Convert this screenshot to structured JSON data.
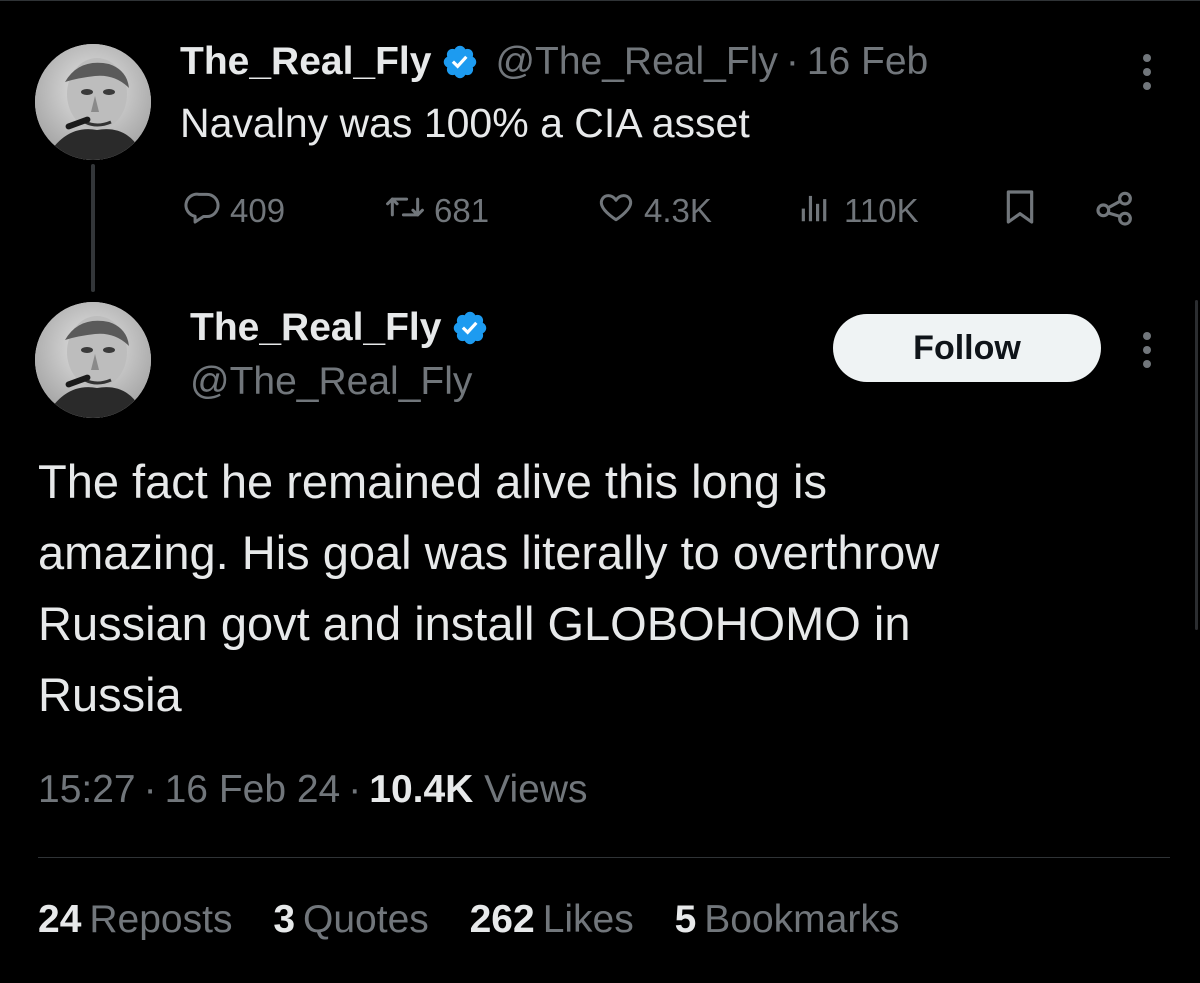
{
  "tweet1": {
    "display_name": "The_Real_Fly",
    "handle": "@The_Real_Fly",
    "separator": "·",
    "date": "16 Feb",
    "text": "Navalny was 100% a CIA asset",
    "actions": {
      "replies": "409",
      "reposts": "681",
      "likes": "4.3K",
      "views": "110K"
    }
  },
  "tweet2": {
    "display_name": "The_Real_Fly",
    "handle": "@The_Real_Fly",
    "follow_label": "Follow",
    "text_lines": [
      "The fact he remained alive this long is",
      "amazing. His goal was literally to overthrow",
      "Russian govt and install GLOBOHOMO in",
      "Russia"
    ],
    "time": "15:27",
    "separator": "·",
    "date": "16 Feb 24",
    "views_count": "10.4K",
    "views_label": "Views",
    "stats": {
      "reposts_count": "24",
      "reposts_label": "Reposts",
      "quotes_count": "3",
      "quotes_label": "Quotes",
      "likes_count": "262",
      "likes_label": "Likes",
      "bookmarks_count": "5",
      "bookmarks_label": "Bookmarks"
    }
  },
  "colors": {
    "background": "#000000",
    "primary_text": "#e7e9ea",
    "secondary_text": "#71767b",
    "verified_blue": "#1d9bf0",
    "follow_button_bg": "#eff3f4",
    "divider": "#2f3336"
  },
  "icons": [
    "verified-badge-icon",
    "more-icon",
    "reply-icon",
    "repost-icon",
    "like-icon",
    "views-icon",
    "bookmark-icon",
    "share-icon"
  ]
}
